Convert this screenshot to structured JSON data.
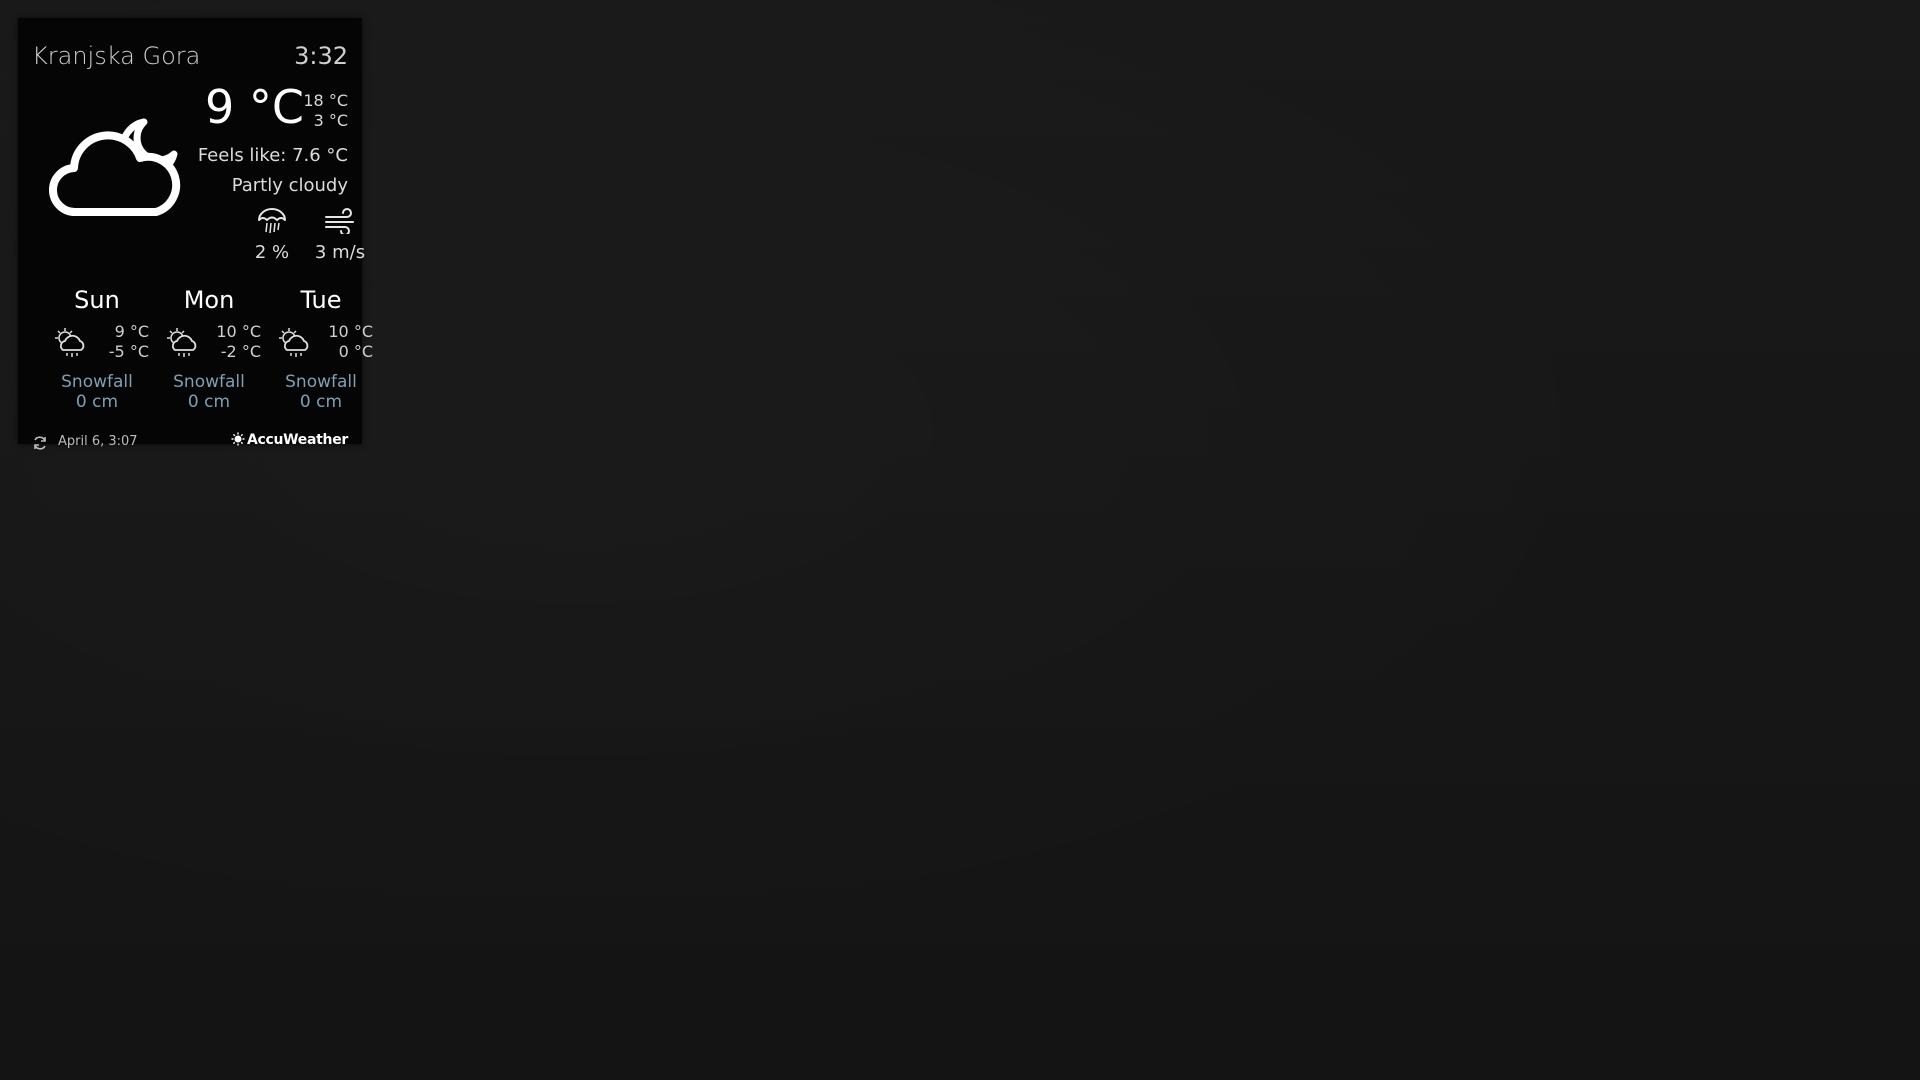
{
  "location": {
    "city": "Kranjska Gora",
    "time": "3:32"
  },
  "current": {
    "icon": "partly-cloudy-night-icon",
    "temperature": "9 °C",
    "high": "18 °C",
    "low": "3 °C",
    "feels_like": "Feels like: 7.6 °C",
    "condition": "Partly cloudy",
    "precipitation": "2 %",
    "wind": "3 m/s"
  },
  "forecast": [
    {
      "day": "Sun",
      "icon": "sun-cloud-rain-icon",
      "high": "9 °C",
      "low": "-5 °C",
      "snow_label": "Snowfall",
      "snow_amount": "0 cm"
    },
    {
      "day": "Mon",
      "icon": "sun-cloud-rain-icon",
      "high": "10 °C",
      "low": "-2 °C",
      "snow_label": "Snowfall",
      "snow_amount": "0 cm"
    },
    {
      "day": "Tue",
      "icon": "sun-cloud-rain-icon",
      "high": "10 °C",
      "low": "0 °C",
      "snow_label": "Snowfall",
      "snow_amount": "0 cm"
    }
  ],
  "footer": {
    "updated": "April  6, 3:07",
    "brand": "AccuWeather"
  },
  "colors": {
    "background": "#161616",
    "widget": "#050505",
    "text": "#f2f2f2",
    "snow_text": "#7f9fb3"
  }
}
